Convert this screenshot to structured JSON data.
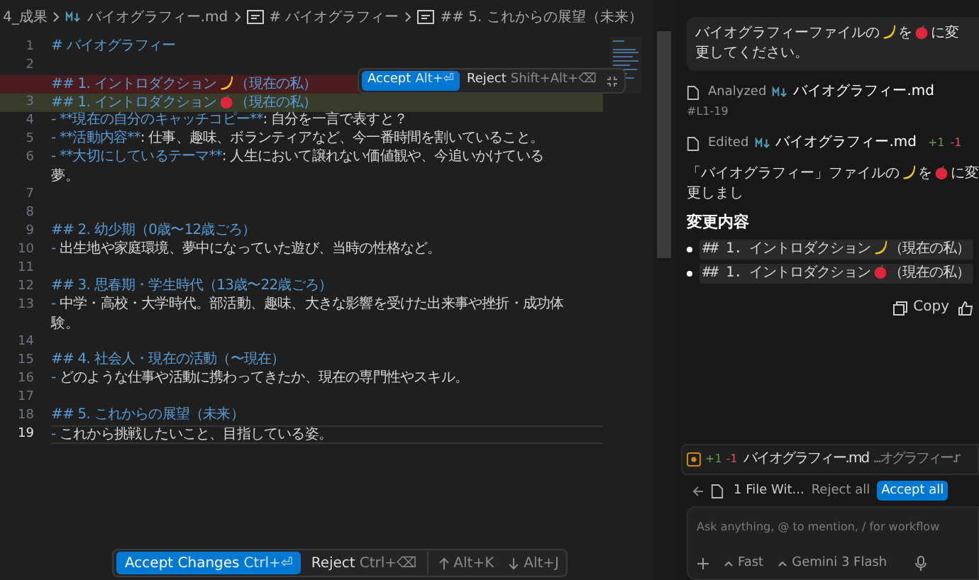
{
  "breadcrumb": [
    {
      "kind": "folder",
      "text": "4_成果"
    },
    {
      "kind": "markdown",
      "text": "バイオグラフィー.md"
    },
    {
      "kind": "section",
      "text": "# バイオグラフィー"
    },
    {
      "kind": "section",
      "text": "## 5. これからの展望（未来）"
    }
  ],
  "editor": {
    "lines": [
      {
        "number": "1",
        "kind": "normal",
        "active": false,
        "parts": [
          {
            "kind": "heading",
            "text": "# バイオグラフィー"
          }
        ]
      },
      {
        "number": "2",
        "kind": "normal",
        "active": false
      },
      {
        "kind": "deleted",
        "active": false,
        "parts": [
          {
            "kind": "heading",
            "text": "## 1. イントロダクション"
          },
          {
            "kind": "banana"
          },
          {
            "kind": "heading",
            "text": "（現在の私）"
          }
        ]
      },
      {
        "number": "3",
        "kind": "added",
        "active": false,
        "parts": [
          {
            "kind": "heading",
            "text": "## 1. イントロダクション"
          },
          {
            "kind": "apple"
          },
          {
            "kind": "heading",
            "text": "（現在の私）"
          }
        ]
      },
      {
        "number": "4",
        "kind": "normal",
        "active": false,
        "parts": [
          {
            "kind": "syntax",
            "text": "- "
          },
          {
            "kind": "heading",
            "text": "**現在の自分のキャッチコピー**"
          },
          {
            "kind": "plain",
            "text": ": 自分を一言で表すと？"
          }
        ]
      },
      {
        "number": "5",
        "kind": "normal",
        "active": false,
        "parts": [
          {
            "kind": "syntax",
            "text": "- "
          },
          {
            "kind": "heading",
            "text": "**活動内容**"
          },
          {
            "kind": "plain",
            "text": ": 仕事、趣味、ボランティアなど、今一番時間を割いていること。"
          }
        ]
      },
      {
        "number": "6",
        "kind": "normal",
        "active": false,
        "parts": [
          {
            "kind": "syntax",
            "text": "- "
          },
          {
            "kind": "heading",
            "text": "**大切にしているテーマ**"
          },
          {
            "kind": "plain",
            "text": ": 人生において譲れない価値観や、今追いかけている"
          }
        ],
        "wrap": "夢。"
      },
      {
        "number": "7",
        "kind": "normal",
        "active": false
      },
      {
        "number": "8",
        "kind": "normal",
        "active": false
      },
      {
        "number": "9",
        "kind": "normal",
        "active": false,
        "parts": [
          {
            "kind": "heading",
            "text": "## 2. 幼少期（0歳〜12歳ごろ）"
          }
        ]
      },
      {
        "number": "10",
        "kind": "normal",
        "active": false,
        "parts": [
          {
            "kind": "syntax",
            "text": "- "
          },
          {
            "kind": "plain",
            "text": "出生地や家庭環境、夢中になっていた遊び、当時の性格など。"
          }
        ]
      },
      {
        "number": "11",
        "kind": "normal",
        "active": false
      },
      {
        "number": "12",
        "kind": "normal",
        "active": false,
        "parts": [
          {
            "kind": "heading",
            "text": "## 3. 思春期・学生時代（13歳〜22歳ごろ）"
          }
        ]
      },
      {
        "number": "13",
        "kind": "normal",
        "active": false,
        "parts": [
          {
            "kind": "syntax",
            "text": "- "
          },
          {
            "kind": "plain",
            "text": "中学・高校・大学時代。部活動、趣味、大きな影響を受けた出来事や挫折・成功体"
          }
        ],
        "wrap": "験。"
      },
      {
        "number": "14",
        "kind": "normal",
        "active": false
      },
      {
        "number": "15",
        "kind": "normal",
        "active": false,
        "parts": [
          {
            "kind": "heading",
            "text": "## 4. 社会人・現在の活動（〜現在）"
          }
        ]
      },
      {
        "number": "16",
        "kind": "normal",
        "active": false,
        "parts": [
          {
            "kind": "syntax",
            "text": "- "
          },
          {
            "kind": "plain",
            "text": "どのような仕事や活動に携わってきたか、現在の専門性やスキル。"
          }
        ]
      },
      {
        "number": "17",
        "kind": "normal",
        "active": false
      },
      {
        "number": "18",
        "kind": "normal",
        "active": false,
        "parts": [
          {
            "kind": "heading",
            "text": "## 5. これからの展望（未来）"
          }
        ]
      },
      {
        "number": "19",
        "kind": "normal",
        "active": true,
        "parts": [
          {
            "kind": "syntax",
            "text": "- "
          },
          {
            "kind": "plain",
            "text": "これから挑戦したいこと、目指している姿。"
          }
        ]
      }
    ],
    "inline_diff": {
      "accept": "Accept",
      "accept_key": "Alt+⏎",
      "reject": "Reject",
      "reject_key": "Shift+Alt+⌫"
    },
    "review_bar": {
      "accept": "Accept Changes",
      "accept_key": "Ctrl+⏎",
      "reject": "Reject",
      "reject_key": "Ctrl+⌫",
      "prev": "Alt+K",
      "next": "Alt+J"
    }
  },
  "chat": {
    "user_message": [
      {
        "kind": "text",
        "text": "バイオグラフィーファイルの"
      },
      {
        "kind": "banana"
      },
      {
        "kind": "text",
        "text": "を"
      },
      {
        "kind": "apple"
      },
      {
        "kind": "text",
        "text": "に変更してください。"
      }
    ],
    "steps": [
      {
        "action": "Analyzed",
        "file": "バイオグラフィー.md",
        "range": "#L1-19"
      },
      {
        "action": "Edited",
        "file": "バイオグラフィー.md",
        "added": "+1",
        "removed": "-1"
      }
    ],
    "reply": [
      {
        "kind": "text",
        "text": "「バイオグラフィー」ファイルの"
      },
      {
        "kind": "banana"
      },
      {
        "kind": "text",
        "text": "を"
      },
      {
        "kind": "apple"
      },
      {
        "kind": "text",
        "text": "に変更しまし"
      }
    ],
    "heading": "変更内容",
    "bullets": [
      [
        {
          "kind": "text",
          "text": "## 1. イントロダクション"
        },
        {
          "kind": "banana"
        },
        {
          "kind": "text",
          "text": "（現在の私）"
        }
      ],
      [
        {
          "kind": "text",
          "text": "## 1. イントロダクション"
        },
        {
          "kind": "apple"
        },
        {
          "kind": "text",
          "text": "（現在の私）"
        }
      ]
    ],
    "copy": "Copy",
    "changed_file": {
      "added": "+1",
      "removed": "-1",
      "name": "バイオグラフィー.md",
      "path": "...オグラフィー.r"
    },
    "files_bar": {
      "summary": "1 File Wit...",
      "reject": "Reject all",
      "accept": "Accept all"
    },
    "input": {
      "placeholder": "Ask anything, @ to mention, / for workflow",
      "mode": "Fast",
      "model": "Gemini 3 Flash"
    }
  }
}
